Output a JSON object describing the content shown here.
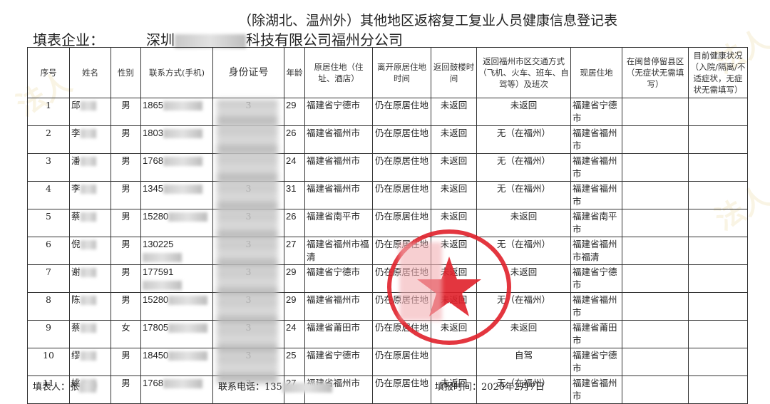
{
  "title": "（除湖北、温州外）其他地区返榕复工复业人员健康信息登记表",
  "company_label": "填表企业：",
  "company_prefix": "深圳",
  "company_suffix": "科技有限公司福州分公司",
  "headers": [
    "序号",
    "姓名",
    "性别",
    "联系方式(手机)",
    "身份证号",
    "年龄",
    "原居住地（住址、酒店）",
    "离开原居住地时间",
    "返回鼓楼时间",
    "返回福州市区交通方式（飞机、火车、班车、自驾等）及班次",
    "现居住地",
    "在闽曾停留县区（无症状无需填写）",
    "目前健康状况（入院/隔离/不适症状，无症状无需填写）"
  ],
  "rows": [
    {
      "no": "1",
      "name": "邱",
      "gender": "男",
      "phone": "1865",
      "id": "3",
      "age": "29",
      "origin": "福建省宁德市",
      "left": "仍在原居住地",
      "return": "未返回",
      "transport": "未返回",
      "current": "福建省宁德市",
      "stay": "",
      "health": ""
    },
    {
      "no": "2",
      "name": "李",
      "gender": "男",
      "phone": "1803",
      "id": "",
      "age": "26",
      "origin": "福建省福州市",
      "left": "仍在原居住地",
      "return": "未返回",
      "transport": "无（在福州）",
      "current": "福建省福州市",
      "stay": "",
      "health": ""
    },
    {
      "no": "3",
      "name": "潘",
      "gender": "男",
      "phone": "1768",
      "id": "",
      "age": "24",
      "origin": "福建省福州市",
      "left": "仍在原居住地",
      "return": "未返回",
      "transport": "无（在福州）",
      "current": "福建省福州市",
      "stay": "",
      "health": ""
    },
    {
      "no": "4",
      "name": "李",
      "gender": "男",
      "phone": "1345",
      "id": "3",
      "age": "31",
      "origin": "福建省福州市",
      "left": "仍在原居住地",
      "return": "未返回",
      "transport": "无（在福州）",
      "current": "福建省福州市",
      "stay": "",
      "health": ""
    },
    {
      "no": "5",
      "name": "蔡",
      "gender": "男",
      "phone": "15280",
      "id": "3",
      "age": "26",
      "origin": "福建省南平市",
      "left": "仍在原居住地",
      "return": "未返回",
      "transport": "未返回",
      "current": "福建省南平市",
      "stay": "",
      "health": ""
    },
    {
      "no": "6",
      "name": "倪",
      "gender": "男",
      "phone": "130225",
      "id": "3",
      "age": "27",
      "origin": "福建省福州市福清",
      "left": "仍在原居住地",
      "return": "未返回",
      "transport": "无（在福州）",
      "current": "福建省福州市福清",
      "stay": "",
      "health": ""
    },
    {
      "no": "7",
      "name": "谢",
      "gender": "男",
      "phone": "177591",
      "id": "3",
      "age": "29",
      "origin": "福建省宁德市",
      "left": "仍在原居住地",
      "return": "未返回",
      "transport": "未返回",
      "current": "福建省宁德市",
      "stay": "",
      "health": ""
    },
    {
      "no": "8",
      "name": "陈",
      "gender": "男",
      "phone": "15280",
      "id": "3",
      "age": "29",
      "origin": "福建省福州市",
      "left": "仍在原居住地",
      "return": "未返回",
      "transport": "无（在福州）",
      "current": "福建省福州市",
      "stay": "",
      "health": ""
    },
    {
      "no": "9",
      "name": "蔡",
      "gender": "女",
      "phone": "17805",
      "id": "3",
      "age": "24",
      "origin": "福建省莆田市",
      "left": "仍在原居住地",
      "return": "未返回",
      "transport": "未返回",
      "current": "福建省莆田市",
      "stay": "",
      "health": ""
    },
    {
      "no": "10",
      "name": "缪",
      "gender": "男",
      "phone": "18450",
      "id": "3",
      "age": "25",
      "origin": "福建省宁德市",
      "left": "仍在原居住地",
      "return": "",
      "transport": "自驾",
      "current": "福建省宁德市",
      "stay": "",
      "health": ""
    },
    {
      "no": "11",
      "name": "姚",
      "gender": "男",
      "phone": "1768",
      "id": "3",
      "age": "27",
      "origin": "福建省福州市",
      "left": "仍在原居住地",
      "return": "未返回",
      "transport": "无（在福州）",
      "current": "福建省福州市",
      "stay": "",
      "health": ""
    }
  ],
  "footer": {
    "filler_label": "填表人：",
    "filler_name": "张",
    "contact_label": "联系电话：",
    "contact_value": "135",
    "date_label": "填报时间：",
    "date_value": "2020年2月7日"
  },
  "stamp": {
    "text": "科技有限公司",
    "color": "#e0202a"
  },
  "watermark": "法人"
}
